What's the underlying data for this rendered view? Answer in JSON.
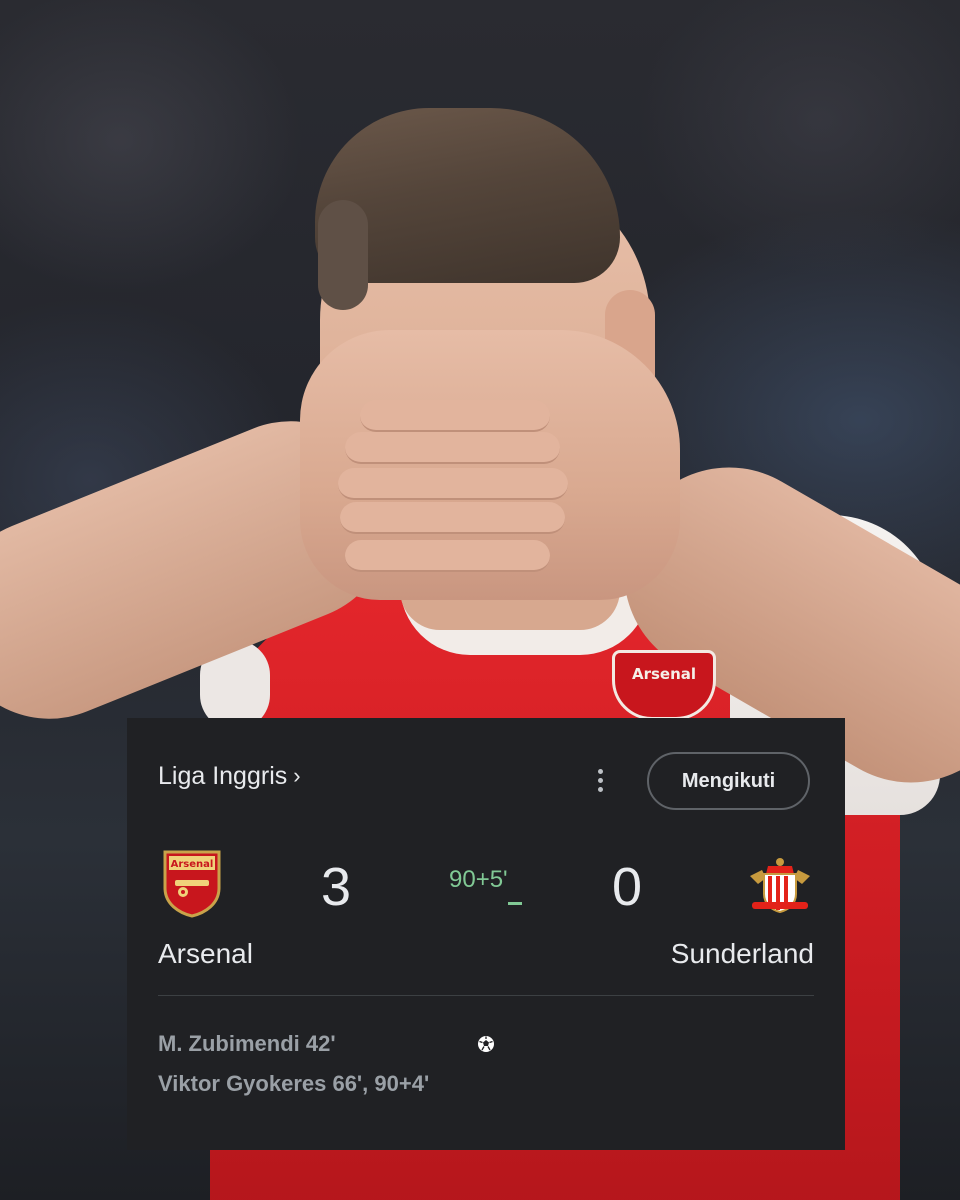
{
  "shirt_crest_text": "Arsenal",
  "card": {
    "league_label": "Liga Inggris",
    "follow_label": "Mengikuti",
    "home": {
      "name": "Arsenal",
      "score": "3",
      "logo_icon": "arsenal-crest-icon",
      "crest_text": "Arsenal"
    },
    "away": {
      "name": "Sunderland",
      "score": "0",
      "logo_icon": "sunderland-crest-icon"
    },
    "match_time": "90+5'",
    "scorers": [
      "M. Zubimendi 42'",
      "Viktor Gyokeres 66', 90+4'"
    ],
    "colors": {
      "card_bg": "#202124",
      "text": "#e8eaed",
      "secondary_text": "#9aa0a6",
      "live_green": "#81c995",
      "arsenal_red": "#db0007"
    }
  }
}
